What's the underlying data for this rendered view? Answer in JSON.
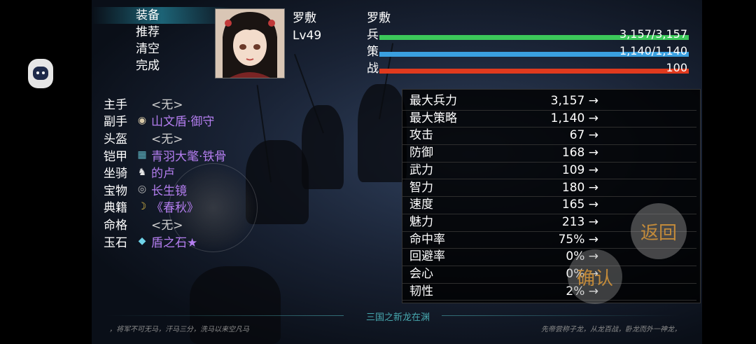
{
  "menu": {
    "items": [
      {
        "label": "装备",
        "active": true
      },
      {
        "label": "推荐",
        "active": false
      },
      {
        "label": "清空",
        "active": false
      },
      {
        "label": "完成",
        "active": false
      }
    ]
  },
  "hero": {
    "name": "罗敷",
    "level": "Lv49",
    "name_right": "罗敷"
  },
  "bars": [
    {
      "label": "兵",
      "value": "3,157/3,157",
      "fraction": 1.0,
      "color": "#3cc85a"
    },
    {
      "label": "策",
      "value": "1,140/1,140",
      "fraction": 1.0,
      "color": "#3aa0e0"
    },
    {
      "label": "战",
      "value": "100",
      "fraction": 1.0,
      "color": "#e03a1e"
    }
  ],
  "equipment": [
    {
      "slot": "主手",
      "icon": "",
      "value": "<无>",
      "empty": true
    },
    {
      "slot": "副手",
      "icon": "shield-icon",
      "value": "山文盾·御守",
      "empty": false
    },
    {
      "slot": "头盔",
      "icon": "",
      "value": "<无>",
      "empty": true
    },
    {
      "slot": "铠甲",
      "icon": "armor-icon",
      "value": "青羽大氅·铁骨",
      "empty": false
    },
    {
      "slot": "坐骑",
      "icon": "horse-icon",
      "value": "的卢",
      "empty": false
    },
    {
      "slot": "宝物",
      "icon": "mirror-icon",
      "value": "长生镜",
      "empty": false
    },
    {
      "slot": "典籍",
      "icon": "scroll-icon",
      "value": "《春秋》",
      "empty": false
    },
    {
      "slot": "命格",
      "icon": "",
      "value": "<无>",
      "empty": true
    },
    {
      "slot": "玉石",
      "icon": "gem-icon",
      "value": "盾之石★",
      "empty": false
    }
  ],
  "stats": [
    {
      "name": "最大兵力",
      "value": "3,157 →"
    },
    {
      "name": "最大策略",
      "value": "1,140 →"
    },
    {
      "name": "攻击",
      "value": "67 →"
    },
    {
      "name": "防御",
      "value": "168 →"
    },
    {
      "name": "武力",
      "value": "109 →"
    },
    {
      "name": "智力",
      "value": "180 →"
    },
    {
      "name": "速度",
      "value": "165 →"
    },
    {
      "name": "魅力",
      "value": "213 →"
    },
    {
      "name": "命中率",
      "value": "75% →"
    },
    {
      "name": "回避率",
      "value": "0% →"
    },
    {
      "name": "会心",
      "value": "0% →"
    },
    {
      "name": "韧性",
      "value": "2% →"
    }
  ],
  "buttons": {
    "return_label": "返回",
    "confirm_label": "确认"
  },
  "footer": {
    "title": "三国之新龙在渊",
    "left_text": "，将军不可无马，汗马三分，洗马以来空凡马",
    "right_text": "先帝尝称子龙，从龙百战，卧龙而外一神龙，"
  }
}
